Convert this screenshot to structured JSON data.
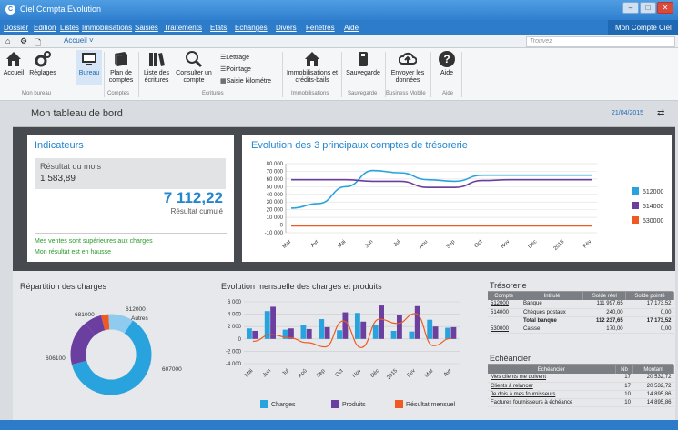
{
  "window": {
    "title": "Ciel Compta Evolution",
    "account_button": "Mon Compte Ciel"
  },
  "menu": [
    "Dossier",
    "Edition",
    "Listes",
    "Immobilisations",
    "Saisies",
    "Traitements",
    "Etats",
    "Echanges",
    "Divers",
    "Fenêtres",
    "Aide"
  ],
  "tabbar": {
    "tab": "Accueil",
    "search_placeholder": "Trouvez"
  },
  "ribbon": {
    "mon_bureau": {
      "label": "Mon bureau",
      "items": [
        "Accueil",
        "Réglages",
        "Bureau"
      ]
    },
    "comptes": {
      "label": "Comptes",
      "items": [
        "Plan de comptes"
      ]
    },
    "ecritures": {
      "label": "Ecritures",
      "items": [
        "Liste des écritures",
        "Consulter un compte"
      ],
      "small": [
        "Lettrage",
        "Pointage",
        "Saisie kilométre"
      ]
    },
    "immobilisations": {
      "label": "Immobilisations",
      "items": [
        "Immobilisations et crédits-bails"
      ]
    },
    "sauvegarde": {
      "label": "Sauvegarde",
      "items": [
        "Sauvegarde"
      ]
    },
    "business": {
      "label": "Business Mobile",
      "items": [
        "Envoyer les données"
      ]
    },
    "aide": {
      "label": "Aide",
      "items": [
        "Aide"
      ]
    }
  },
  "dashboard": {
    "title": "Mon tableau de bord",
    "date": "21/04/2015"
  },
  "indicateurs": {
    "title": "Indicateurs",
    "resultat_mois_label": "Résultat du mois",
    "resultat_mois_value": "1 583,89",
    "cumul_value": "7 112,22",
    "cumul_label": "Résultat cumulé",
    "msg1": "Mes ventes sont supérieures aux charges",
    "msg2": "Mon résultat est en hausse"
  },
  "colors": {
    "c512000": "#29a3dd",
    "c514000": "#6b3fa0",
    "c530000": "#f05a22",
    "charges": "#29a3dd",
    "produits": "#6b3fa0",
    "resultat": "#f05a22"
  },
  "chart_data": [
    {
      "type": "line",
      "title": "Evolution des 3 principaux comptes de trésorerie",
      "categories": [
        "Mar",
        "Avr",
        "Mai",
        "Jun",
        "Jul",
        "Aou",
        "Sep",
        "Oct",
        "Nov",
        "Déc",
        "2015",
        "Fév"
      ],
      "ylim": [
        -10000,
        80000
      ],
      "yticks": [
        "80 000",
        "70 000",
        "60 000",
        "50 000",
        "40 000",
        "30 000",
        "20 000",
        "10 000",
        "0",
        "-10 000"
      ],
      "series": [
        {
          "name": "512000",
          "values": [
            22000,
            28000,
            50000,
            71000,
            68000,
            59000,
            57000,
            65000,
            65000,
            65000,
            65000,
            65000
          ]
        },
        {
          "name": "514000",
          "values": [
            59000,
            59000,
            59000,
            57000,
            57000,
            49000,
            49000,
            58000,
            59000,
            59000,
            59000,
            59000
          ]
        },
        {
          "name": "530000",
          "values": [
            -1000,
            -1000,
            -1000,
            -1000,
            -1000,
            -1000,
            -1000,
            -1000,
            -1000,
            -1000,
            -1000,
            -1000
          ]
        }
      ]
    },
    {
      "type": "pie",
      "title": "Répartition des charges",
      "labels": [
        "612000",
        "Autres",
        "607000",
        "606100",
        "681000"
      ],
      "values": [
        3,
        10,
        62,
        18,
        7
      ]
    },
    {
      "type": "bar",
      "title": "Evolution mensuelle des charges et produits",
      "categories": [
        "Mai",
        "Jun",
        "Jul",
        "Aoû",
        "Sep",
        "Oct",
        "Nov",
        "Déc",
        "2015",
        "Fév",
        "Mar",
        "Avr"
      ],
      "yticks": [
        "6 000",
        "4 000",
        "2 000",
        "0",
        "-2 000",
        "-4 000"
      ],
      "ylim": [
        -4000,
        6000
      ],
      "series": [
        {
          "name": "Charges",
          "values": [
            1700,
            4500,
            1500,
            2200,
            3200,
            1400,
            4200,
            2200,
            1300,
            1200,
            3100,
            1800
          ]
        },
        {
          "name": "Produits",
          "values": [
            1300,
            5200,
            1700,
            1600,
            1900,
            4300,
            2800,
            5400,
            3800,
            5300,
            2000,
            1900
          ]
        },
        {
          "name": "Résultat mensuel",
          "values": [
            -400,
            700,
            200,
            -600,
            -1300,
            2900,
            -1400,
            3200,
            2500,
            4100,
            -1100,
            100
          ]
        }
      ]
    }
  ],
  "tresorerie": {
    "title": "Trésorerie",
    "headers": [
      "Compte",
      "Intitulé",
      "Solde réel",
      "Solde pointé"
    ],
    "rows": [
      [
        "512000",
        "Banque",
        "111 997,65",
        "17 173,52"
      ],
      [
        "514000",
        "Chèques postaux",
        "240,00",
        "0,00"
      ],
      [
        "",
        "Total banque",
        "112 237,65",
        "17 173,52"
      ],
      [
        "530000",
        "Caisse",
        "170,00",
        "0,00"
      ]
    ]
  },
  "echeancier": {
    "title": "Echéancier",
    "headers": [
      "Echéancier",
      "Nb",
      "Montant"
    ],
    "rows": [
      [
        "Mes clients me doivent",
        "17",
        "20 532,72"
      ],
      [
        "Clients à relancer",
        "17",
        "20 532,72"
      ],
      [
        "Je dois à mes fournisseurs",
        "10",
        "14 895,86"
      ],
      [
        "Factures fournisseurs à échéance",
        "10",
        "14 895,86"
      ]
    ]
  }
}
